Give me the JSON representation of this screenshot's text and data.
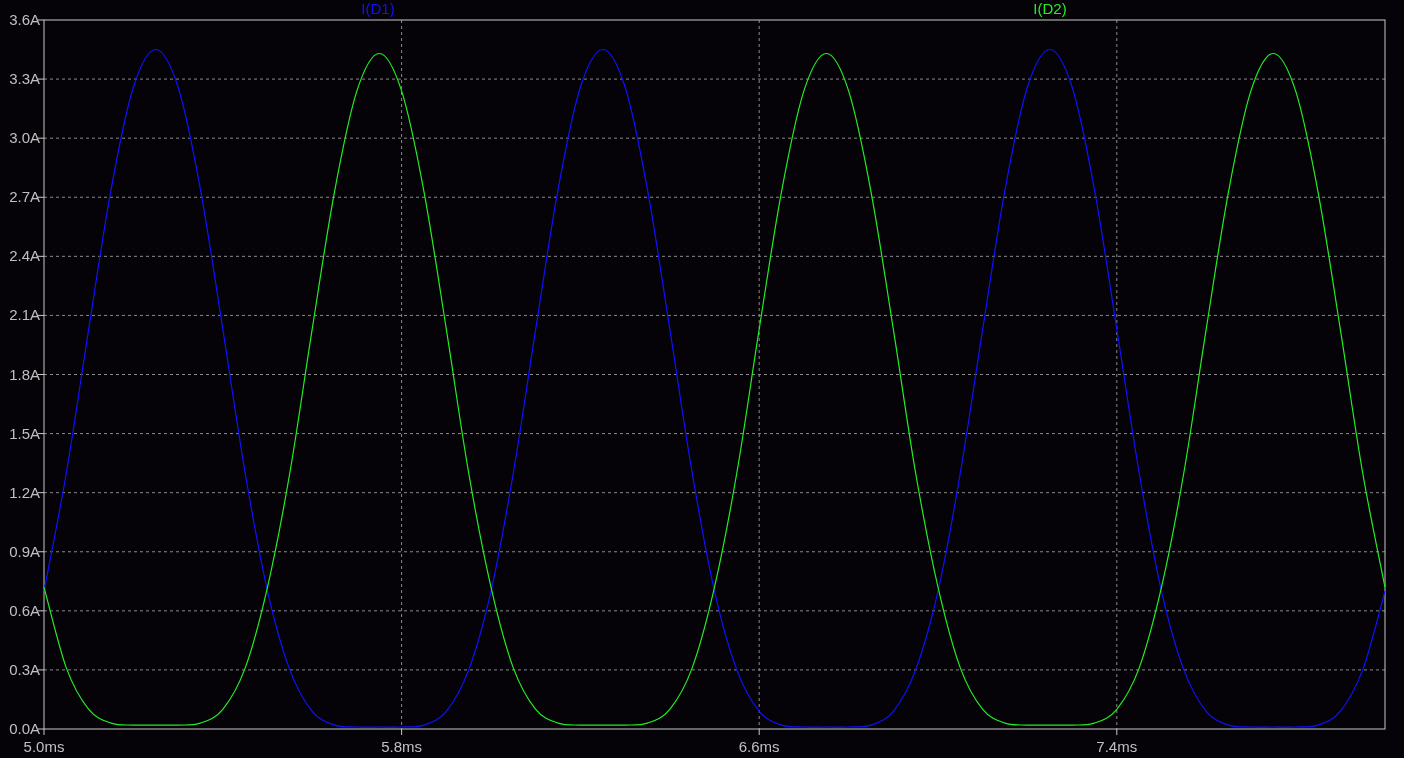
{
  "chart_data": {
    "type": "line",
    "grid": true,
    "xlim": [
      5.0,
      8.0
    ],
    "ylim": [
      0,
      3.6
    ],
    "xticks": [
      {
        "value": 5.0,
        "label": "5.0ms"
      },
      {
        "value": 5.8,
        "label": "5.8ms"
      },
      {
        "value": 6.6,
        "label": "6.6ms"
      },
      {
        "value": 7.4,
        "label": "7.4ms"
      }
    ],
    "yticks": [
      {
        "value": 0,
        "label": "0.0A"
      },
      {
        "value": 0.3,
        "label": "0.3A"
      },
      {
        "value": 0.6,
        "label": "0.6A"
      },
      {
        "value": 0.9,
        "label": "0.9A"
      },
      {
        "value": 1.2,
        "label": "1.2A"
      },
      {
        "value": 1.5,
        "label": "1.5A"
      },
      {
        "value": 1.8,
        "label": "1.8A"
      },
      {
        "value": 2.1,
        "label": "2.1A"
      },
      {
        "value": 2.4,
        "label": "2.4A"
      },
      {
        "value": 2.7,
        "label": "2.7A"
      },
      {
        "value": 3.0,
        "label": "3.0A"
      },
      {
        "value": 3.3,
        "label": "3.3A"
      },
      {
        "value": 3.6,
        "label": "3.6A"
      }
    ],
    "x": [
      5.0,
      5.05,
      5.1,
      5.15,
      5.2,
      5.25,
      5.3,
      5.35,
      5.4,
      5.45,
      5.5,
      5.55,
      5.6,
      5.65,
      5.7,
      5.75,
      5.8,
      5.85,
      5.9,
      5.95,
      6.0,
      6.05,
      6.1,
      6.15,
      6.2,
      6.25,
      6.3,
      6.35,
      6.4,
      6.45,
      6.5,
      6.55,
      6.6,
      6.65,
      6.7,
      6.75,
      6.8,
      6.85,
      6.9,
      6.95,
      7.0,
      7.05,
      7.1,
      7.15,
      7.2,
      7.25,
      7.3,
      7.35,
      7.4,
      7.45,
      7.5,
      7.55,
      7.6,
      7.65,
      7.7,
      7.75,
      7.8,
      7.85,
      7.9,
      7.95,
      8.0
    ],
    "series": [
      {
        "name": "I(D1)",
        "color": "#1010ff",
        "values": [
          0.7,
          1.3,
          2.03,
          2.74,
          3.26,
          3.45,
          3.26,
          2.74,
          2.03,
          1.3,
          0.7,
          0.3,
          0.09,
          0.02,
          0.01,
          0.01,
          0.01,
          0.02,
          0.09,
          0.3,
          0.7,
          1.3,
          2.03,
          2.74,
          3.26,
          3.45,
          3.26,
          2.74,
          2.03,
          1.3,
          0.7,
          0.3,
          0.09,
          0.02,
          0.01,
          0.01,
          0.01,
          0.02,
          0.09,
          0.3,
          0.7,
          1.3,
          2.03,
          2.74,
          3.26,
          3.45,
          3.26,
          2.74,
          2.03,
          1.3,
          0.7,
          0.3,
          0.09,
          0.02,
          0.01,
          0.01,
          0.01,
          0.02,
          0.09,
          0.3,
          0.7
        ]
      },
      {
        "name": "I(D2)",
        "color": "#22ee22",
        "values": [
          0.72,
          0.31,
          0.1,
          0.03,
          0.02,
          0.02,
          0.02,
          0.03,
          0.1,
          0.31,
          0.72,
          1.3,
          2.03,
          2.73,
          3.24,
          3.43,
          3.24,
          2.73,
          2.03,
          1.3,
          0.72,
          0.31,
          0.1,
          0.03,
          0.02,
          0.02,
          0.02,
          0.03,
          0.1,
          0.31,
          0.72,
          1.3,
          2.03,
          2.73,
          3.24,
          3.43,
          3.24,
          2.73,
          2.03,
          1.3,
          0.72,
          0.31,
          0.1,
          0.03,
          0.02,
          0.02,
          0.02,
          0.03,
          0.1,
          0.31,
          0.72,
          1.3,
          2.03,
          2.73,
          3.24,
          3.43,
          3.24,
          2.73,
          2.03,
          1.3,
          0.72
        ]
      }
    ]
  }
}
